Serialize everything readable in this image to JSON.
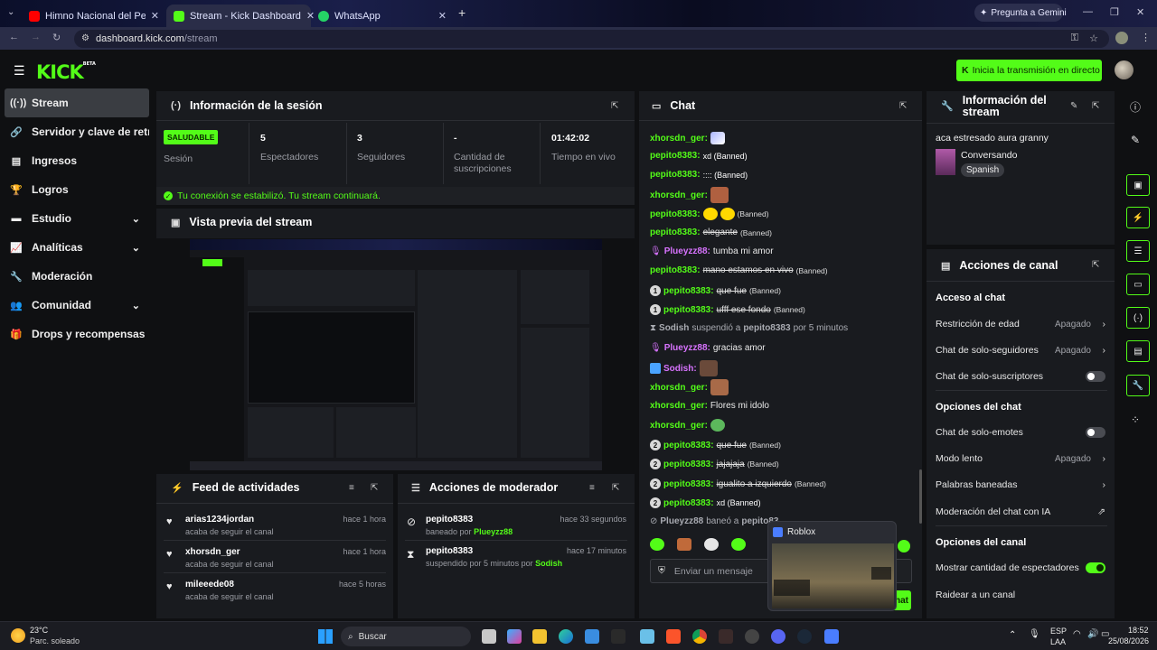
{
  "browser": {
    "tabs": [
      {
        "title": "Himno Nacional del Perú - Sex..."
      },
      {
        "title": "Stream - Kick Dashboard"
      },
      {
        "title": "WhatsApp"
      }
    ],
    "new_tab": "+",
    "gemini": "Pregunta a Gemini",
    "url_host": "dashboard.kick.com",
    "url_path": "/stream"
  },
  "header": {
    "logo": "KICK",
    "logo_badge": "BETA",
    "go_live": "Inicia la transmisión en directo"
  },
  "sidebar": {
    "items": [
      {
        "label": "Stream"
      },
      {
        "label": "Servidor y clave de retransmisión"
      },
      {
        "label": "Ingresos"
      },
      {
        "label": "Logros"
      },
      {
        "label": "Estudio"
      },
      {
        "label": "Analíticas"
      },
      {
        "label": "Moderación"
      },
      {
        "label": "Comunidad"
      },
      {
        "label": "Drops y recompensas"
      }
    ]
  },
  "session": {
    "title": "Información de la sesión",
    "status_badge": "SALUDABLE",
    "status_label": "Sesión",
    "stats": [
      {
        "value": "5",
        "label": "Espectadores"
      },
      {
        "value": "3",
        "label": "Seguidores"
      },
      {
        "value": "-",
        "label": "Cantidad de suscripciones"
      },
      {
        "value": "01:42:02",
        "label": "Tiempo en vivo"
      }
    ],
    "notice": "Tu conexión se estabilizó. Tu stream continuará."
  },
  "preview": {
    "title": "Vista previa del stream"
  },
  "activity": {
    "title": "Feed de actividades",
    "items": [
      {
        "name": "arias1234jordan",
        "desc": "acaba de seguir el canal",
        "time": "hace 1 hora"
      },
      {
        "name": "xhorsdn_ger",
        "desc": "acaba de seguir el canal",
        "time": "hace 1 hora"
      },
      {
        "name": "mileeede08",
        "desc": "acaba de seguir el canal",
        "time": "hace 5 horas"
      }
    ]
  },
  "modactions": {
    "title": "Acciones de moderador",
    "items": [
      {
        "name": "pepito8383",
        "desc_prefix": "baneado por",
        "by": "Plueyzz88",
        "time": "hace 33 segundos"
      },
      {
        "name": "pepito8383",
        "desc_prefix": "suspendido por 5 minutos por",
        "by": "Sodish",
        "time": "hace 17 minutos"
      }
    ]
  },
  "chat": {
    "title": "Chat",
    "banned": "(Banned)",
    "messages": [
      {
        "user": "xhorsdn_ger:",
        "text": ""
      },
      {
        "user": "pepito8383:",
        "text": "xd (Banned)"
      },
      {
        "user": "pepito8383:",
        "text": ":::: (Banned)"
      },
      {
        "user": "xhorsdn_ger:",
        "text": ""
      },
      {
        "user": "pepito8383:",
        "text": ""
      },
      {
        "user": "pepito8383:",
        "text": "elegante"
      },
      {
        "user": "Plueyzz88:",
        "text": "tumba mi amor"
      },
      {
        "user": "pepito8383:",
        "text": "mano estamos en vivo"
      },
      {
        "user": "pepito8383:",
        "text": "que fue"
      },
      {
        "user": "pepito8383:",
        "text": "ufff ese fondo"
      },
      {
        "user": "Sodish",
        "text": "suspendió a",
        "target": "pepito8383",
        "extra": "por 5 minutos"
      },
      {
        "user": "Plueyzz88:",
        "text": "gracias amor"
      },
      {
        "user": "Sodish:",
        "text": ""
      },
      {
        "user": "xhorsdn_ger:",
        "text": ""
      },
      {
        "user": "xhorsdn_ger:",
        "text": "Flores mi idolo"
      },
      {
        "user": "xhorsdn_ger:",
        "text": ""
      },
      {
        "user": "pepito8383:",
        "text": "que fue"
      },
      {
        "user": "pepito8383:",
        "text": "jajajaja"
      },
      {
        "user": "pepito8383:",
        "text": "igualito a izquierdo"
      },
      {
        "user": "pepito8383:",
        "text": "xd (Banned)"
      },
      {
        "user": "Plueyzz88",
        "text": "baneó a",
        "target": "pepito83"
      }
    ],
    "badge_numbers": [
      "1",
      "1",
      "2",
      "2",
      "2",
      "2"
    ],
    "input_placeholder": "Enviar un mensaje",
    "send": "Chat"
  },
  "overlay": {
    "title": "Roblox"
  },
  "stream_info": {
    "title": "Información del stream",
    "stream_title": "aca estresado aura granny",
    "category": "Conversando",
    "language": "Spanish"
  },
  "channel_actions": {
    "title": "Acciones de canal",
    "section_chat_access": "Acceso al chat",
    "age_restriction": "Restricción de edad",
    "age_restriction_value": "Apagado",
    "followers_only": "Chat de solo-seguidores",
    "followers_only_value": "Apagado",
    "subs_only": "Chat de solo-suscriptores",
    "section_chat_options": "Opciones del chat",
    "emotes_only": "Chat de solo-emotes",
    "slow_mode": "Modo lento",
    "slow_mode_value": "Apagado",
    "banned_words": "Palabras baneadas",
    "ai_moderation": "Moderación del chat con IA",
    "section_channel_options": "Opciones del canal",
    "show_viewers": "Mostrar cantidad de espectadores",
    "raid": "Raidear a un canal"
  },
  "taskbar": {
    "weather_temp": "23°C",
    "weather_desc": "Parc. soleado",
    "search": "Buscar",
    "lang": "ESP",
    "lang2": "LAA",
    "time": "18:52",
    "date": "25/08/2026"
  },
  "colors": {
    "accent": "#53fc18",
    "panel": "#191b1f",
    "bg": "#0f1012"
  }
}
